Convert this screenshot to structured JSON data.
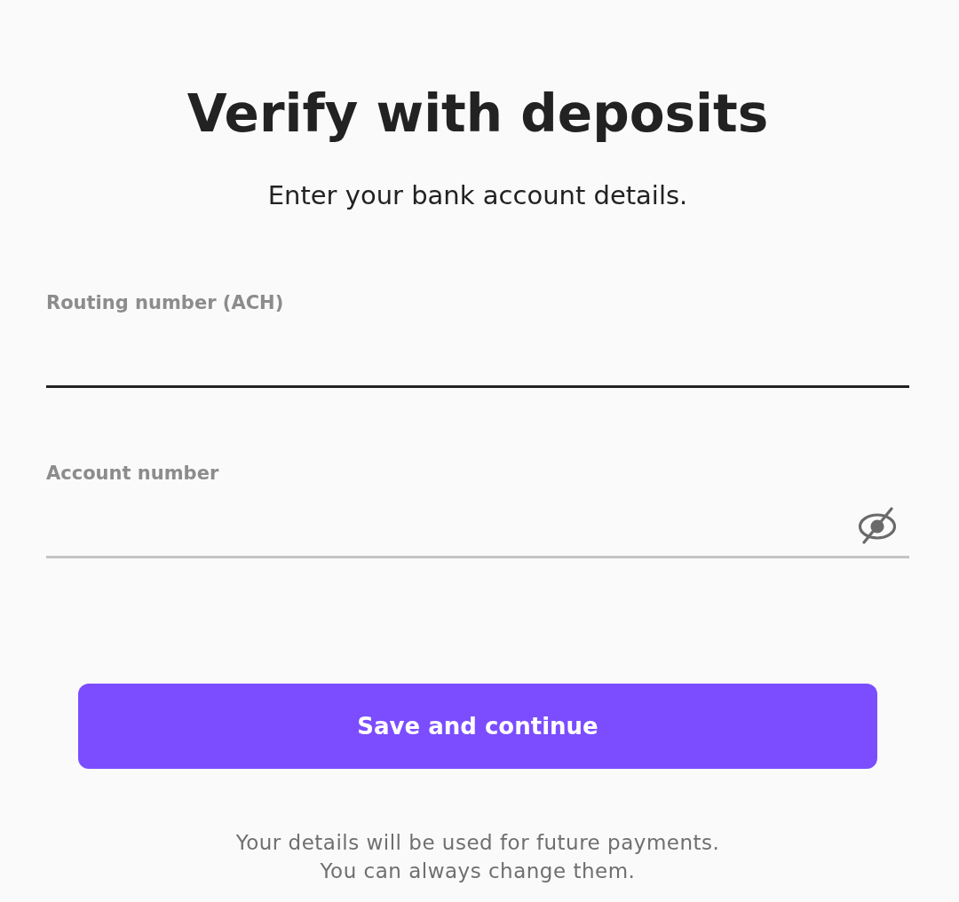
{
  "title": "Verify with deposits",
  "subtitle": "Enter your bank account details.",
  "fields": [
    {
      "kind": "text",
      "label": "Routing number (ACH)",
      "focused": true
    },
    {
      "kind": "secret",
      "label": "Account number",
      "focused": false
    }
  ],
  "button": {
    "label": "Save and continue"
  },
  "note_lines": [
    "Your details will be used for future payments.",
    "You can always change them."
  ]
}
